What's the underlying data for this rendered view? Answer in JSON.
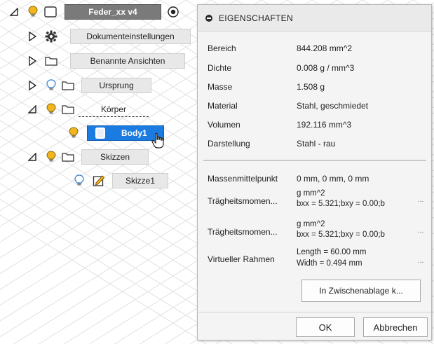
{
  "browser": {
    "root": {
      "label": "Feder_xx v4"
    },
    "items": [
      {
        "label": "Dokumenteinstellungen"
      },
      {
        "label": "Benannte Ansichten"
      },
      {
        "label": "Ursprung"
      },
      {
        "label": "Körper"
      },
      {
        "label": "Body1"
      },
      {
        "label": "Skizzen"
      },
      {
        "label": "Skizze1"
      }
    ]
  },
  "dialog": {
    "title": "EIGENSCHAFTEN",
    "properties": [
      {
        "label": "Bereich",
        "value": "844.208 mm^2"
      },
      {
        "label": "Dichte",
        "value": "0.008 g / mm^3"
      },
      {
        "label": "Masse",
        "value": "1.508 g"
      },
      {
        "label": "Material",
        "value": "Stahl, geschmiedet"
      },
      {
        "label": "Volumen",
        "value": "192.116 mm^3"
      },
      {
        "label": "Darstellung",
        "value": "Stahl - rau"
      }
    ],
    "physical": {
      "center_label": "Massenmittelpunkt",
      "center_value": "0 mm, 0 mm, 0 mm",
      "inertia1_label": "Trägheitsmomen...",
      "inertia1_line1": "g mm^2",
      "inertia1_line2": "bxx = 5.321;bxy = 0.00;b",
      "inertia2_label": "Trägheitsmomen...",
      "inertia2_line1": "g mm^2",
      "inertia2_line2": "bxx = 5.321;bxy = 0.00;b",
      "bbox_label": "Virtueller Rahmen",
      "bbox_line1": "Length = 60.00 mm",
      "bbox_line2": "Width = 0.494 mm",
      "ellipsis": "..."
    },
    "copy_button": "In Zwischenablage k...",
    "ok_button": "OK",
    "cancel_button": "Abbrechen"
  },
  "colors": {
    "selected": "#1b7be0",
    "root_bg": "#7a7a7a",
    "bulb_on": "#f2b51d",
    "bulb_off": "#4a8fd6"
  }
}
